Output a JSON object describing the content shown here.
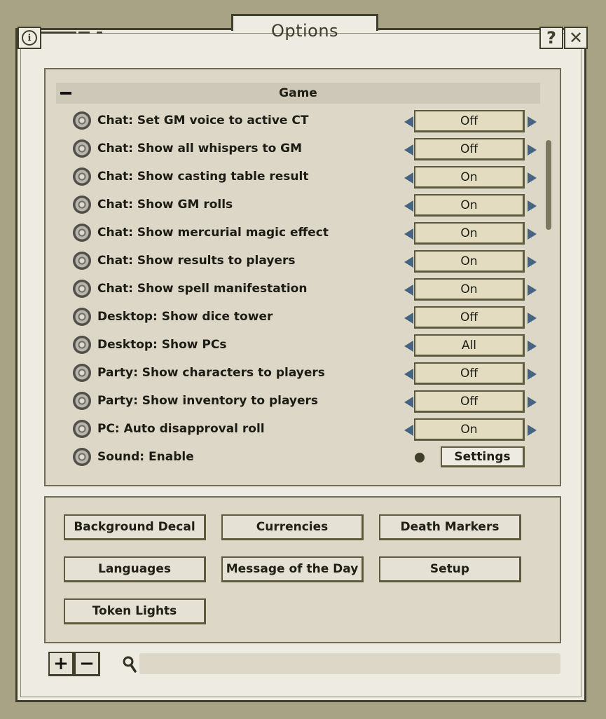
{
  "window": {
    "title": "Options"
  },
  "top_buttons": {
    "help": "?",
    "close": "✕"
  },
  "section": {
    "title": "Game"
  },
  "options": [
    {
      "label": "Chat: Set GM voice to active CT",
      "value": "Off"
    },
    {
      "label": "Chat: Show all whispers to GM",
      "value": "Off"
    },
    {
      "label": "Chat: Show casting table result",
      "value": "On"
    },
    {
      "label": "Chat: Show GM rolls",
      "value": "On"
    },
    {
      "label": "Chat: Show mercurial magic effect",
      "value": "On"
    },
    {
      "label": "Chat: Show results to players",
      "value": "On"
    },
    {
      "label": "Chat: Show spell manifestation",
      "value": "On"
    },
    {
      "label": "Desktop: Show dice tower",
      "value": "Off"
    },
    {
      "label": "Desktop: Show PCs",
      "value": "All"
    },
    {
      "label": "Party: Show characters to players",
      "value": "Off"
    },
    {
      "label": "Party: Show inventory to players",
      "value": "Off"
    },
    {
      "label": "PC: Auto disapproval roll",
      "value": "On"
    }
  ],
  "sound": {
    "label": "Sound: Enable",
    "button": "Settings"
  },
  "bottom_buttons": [
    "Background Decal",
    "Currencies",
    "Death Markers",
    "Languages",
    "Message of the Day",
    "Setup",
    "Token Lights"
  ],
  "footer": {
    "plus": "+",
    "minus": "−",
    "search_value": ""
  },
  "colors": {
    "background": "#a7a384",
    "window": "#eeebe2",
    "panel": "#dcd7c7",
    "value_box": "#e4dcc1",
    "arrow": "#46637f",
    "border": "#3f3f2c"
  }
}
